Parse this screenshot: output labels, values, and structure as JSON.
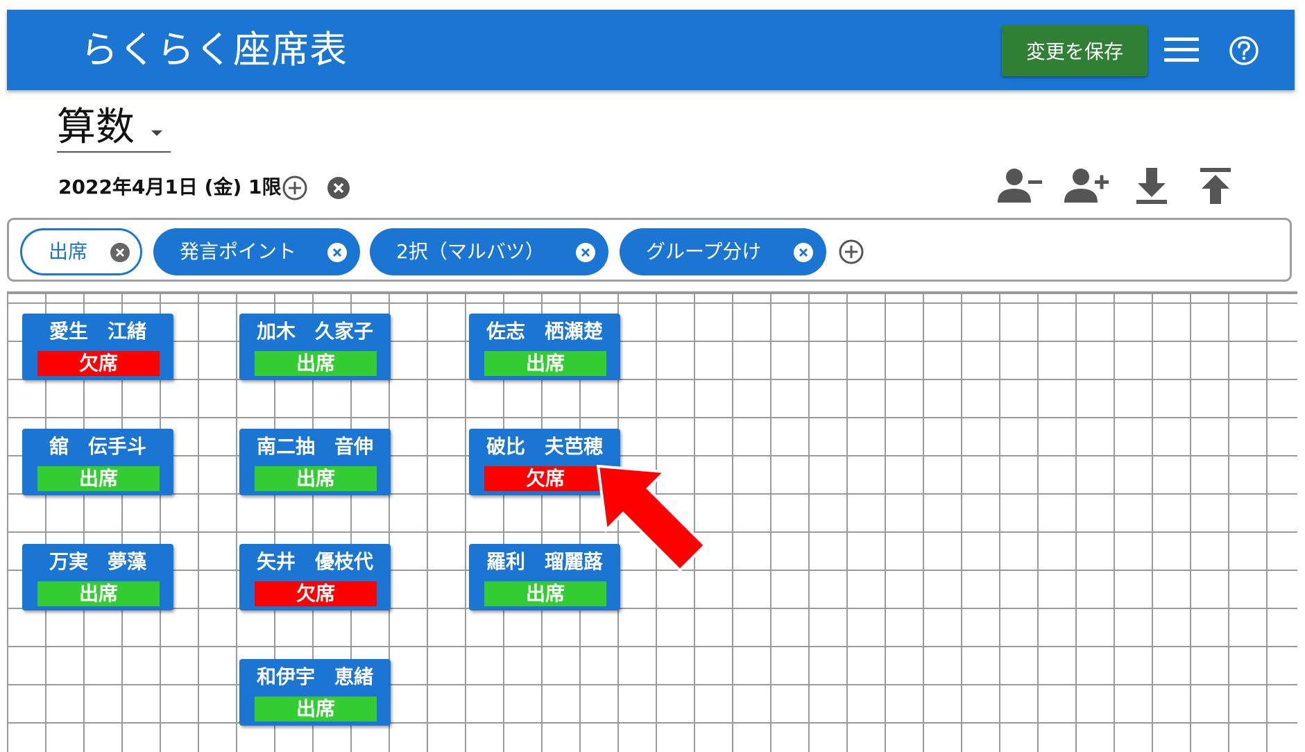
{
  "header": {
    "title": "らくらく座席表",
    "save_label": "変更を保存",
    "menu_icon": "hamburger-menu-icon",
    "help_icon": "help-circle-icon"
  },
  "subject": {
    "value": "算数"
  },
  "session": {
    "label": "2022年4月1日 (金) 1限"
  },
  "toolbar": {
    "icons": [
      "remove-person-icon",
      "add-person-icon",
      "download-icon",
      "upload-icon"
    ]
  },
  "chips": [
    {
      "label": "出席",
      "selected": true
    },
    {
      "label": "発言ポイント",
      "selected": false
    },
    {
      "label": "2択（マルバツ）",
      "selected": false
    },
    {
      "label": "グループ分け",
      "selected": false
    }
  ],
  "colors": {
    "primary": "#1b75d3",
    "save": "#2f7f35",
    "present": "#33cc33",
    "absent": "#ff0000",
    "arrow": "#ff0000"
  },
  "seats": [
    {
      "name": "愛生　江緒",
      "status": "欠席",
      "state": "absent"
    },
    {
      "name": "舘　伝手斗",
      "status": "出席",
      "state": "present"
    },
    {
      "name": "万実　夢藻",
      "status": "出席",
      "state": "present"
    },
    {
      "name": "加木　久家子",
      "status": "出席",
      "state": "present"
    },
    {
      "name": "南二抽　音伸",
      "status": "出席",
      "state": "present"
    },
    {
      "name": "矢井　優枝代",
      "status": "欠席",
      "state": "absent"
    },
    {
      "name": "和伊宇　恵緒",
      "status": "出席",
      "state": "present"
    },
    {
      "name": "佐志　栖瀬楚",
      "status": "出席",
      "state": "present"
    },
    {
      "name": "破比　夫芭穂",
      "status": "欠席",
      "state": "absent"
    },
    {
      "name": "羅利　瑠麗蕗",
      "status": "出席",
      "state": "present"
    }
  ]
}
